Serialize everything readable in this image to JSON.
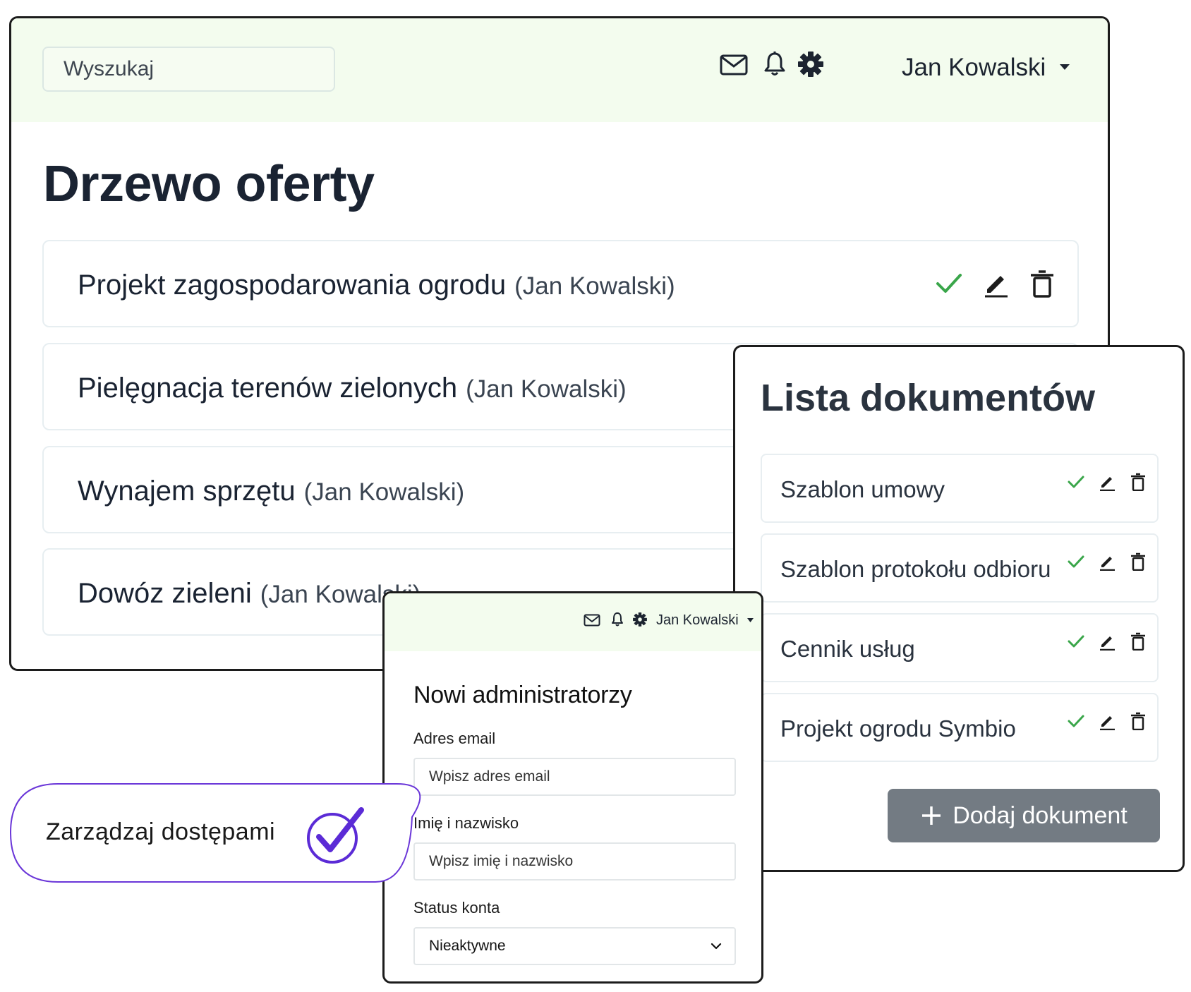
{
  "header": {
    "search_placeholder": "Wyszukaj",
    "user_name": "Jan Kowalski",
    "icons": [
      "mail-icon",
      "bell-icon",
      "gear-icon",
      "caret-down-icon"
    ]
  },
  "main": {
    "title": "Drzewo oferty",
    "offers": [
      {
        "title": "Projekt zagospodarowania ogrodu",
        "author": "(Jan Kowalski)"
      },
      {
        "title": "Pielęgnacja terenów zielonych",
        "author": "(Jan Kowalski)"
      },
      {
        "title": "Wynajem sprzętu",
        "author": "(Jan Kowalski)"
      },
      {
        "title": "Dowóz zieleni",
        "author": "(Jan Kowalski)"
      }
    ]
  },
  "documents": {
    "title": "Lista dokumentów",
    "items": [
      {
        "label": "Szablon umowy"
      },
      {
        "label": "Szablon protokołu odbioru"
      },
      {
        "label": "Cennik usług"
      },
      {
        "label": "Projekt ogrodu Symbio"
      }
    ],
    "add_button": "Dodaj dokument"
  },
  "admin": {
    "user_name": "Jan Kowalski",
    "title": "Nowi administratorzy",
    "email_label": "Adres email",
    "email_placeholder": "Wpisz adres email",
    "name_label": "Imię i nazwisko",
    "name_placeholder": "Wpisz imię i nazwisko",
    "status_label": "Status konta",
    "status_value": "Nieaktywne"
  },
  "callout": {
    "text": "Zarządzaj dostępami"
  },
  "colors": {
    "header_bg": "#f3fcee",
    "check_green": "#3aa64a",
    "button_gray": "#737b83",
    "callout_purple": "#5b2bd6"
  }
}
